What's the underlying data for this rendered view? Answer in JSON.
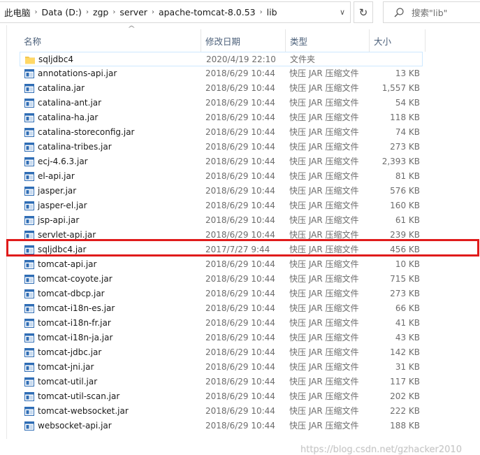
{
  "address_bar": {
    "crumbs": [
      "此电脑",
      "Data (D:)",
      "zgp",
      "server",
      "apache-tomcat-8.0.53",
      "lib"
    ]
  },
  "search": {
    "placeholder": "搜索\"lib\""
  },
  "columns": {
    "name": "名称",
    "date": "修改日期",
    "type": "类型",
    "size": "大小"
  },
  "files": [
    {
      "name": "sqljdbc4",
      "date": "2020/4/19 22:10",
      "type": "文件夹",
      "size": "",
      "icon": "folder-icon"
    },
    {
      "name": "annotations-api.jar",
      "date": "2018/6/29 10:44",
      "type": "快压 JAR 压缩文件",
      "size": "13 KB",
      "icon": "jar-file-icon"
    },
    {
      "name": "catalina.jar",
      "date": "2018/6/29 10:44",
      "type": "快压 JAR 压缩文件",
      "size": "1,557 KB",
      "icon": "jar-file-icon"
    },
    {
      "name": "catalina-ant.jar",
      "date": "2018/6/29 10:44",
      "type": "快压 JAR 压缩文件",
      "size": "54 KB",
      "icon": "jar-file-icon"
    },
    {
      "name": "catalina-ha.jar",
      "date": "2018/6/29 10:44",
      "type": "快压 JAR 压缩文件",
      "size": "118 KB",
      "icon": "jar-file-icon"
    },
    {
      "name": "catalina-storeconfig.jar",
      "date": "2018/6/29 10:44",
      "type": "快压 JAR 压缩文件",
      "size": "74 KB",
      "icon": "jar-file-icon"
    },
    {
      "name": "catalina-tribes.jar",
      "date": "2018/6/29 10:44",
      "type": "快压 JAR 压缩文件",
      "size": "273 KB",
      "icon": "jar-file-icon"
    },
    {
      "name": "ecj-4.6.3.jar",
      "date": "2018/6/29 10:44",
      "type": "快压 JAR 压缩文件",
      "size": "2,393 KB",
      "icon": "jar-file-icon"
    },
    {
      "name": "el-api.jar",
      "date": "2018/6/29 10:44",
      "type": "快压 JAR 压缩文件",
      "size": "81 KB",
      "icon": "jar-file-icon"
    },
    {
      "name": "jasper.jar",
      "date": "2018/6/29 10:44",
      "type": "快压 JAR 压缩文件",
      "size": "576 KB",
      "icon": "jar-file-icon"
    },
    {
      "name": "jasper-el.jar",
      "date": "2018/6/29 10:44",
      "type": "快压 JAR 压缩文件",
      "size": "160 KB",
      "icon": "jar-file-icon"
    },
    {
      "name": "jsp-api.jar",
      "date": "2018/6/29 10:44",
      "type": "快压 JAR 压缩文件",
      "size": "61 KB",
      "icon": "jar-file-icon"
    },
    {
      "name": "servlet-api.jar",
      "date": "2018/6/29 10:44",
      "type": "快压 JAR 压缩文件",
      "size": "239 KB",
      "icon": "jar-file-icon"
    },
    {
      "name": "sqljdbc4.jar",
      "date": "2017/7/27 9:44",
      "type": "快压 JAR 压缩文件",
      "size": "456 KB",
      "icon": "jar-file-icon",
      "highlighted": true
    },
    {
      "name": "tomcat-api.jar",
      "date": "2018/6/29 10:44",
      "type": "快压 JAR 压缩文件",
      "size": "10 KB",
      "icon": "jar-file-icon"
    },
    {
      "name": "tomcat-coyote.jar",
      "date": "2018/6/29 10:44",
      "type": "快压 JAR 压缩文件",
      "size": "715 KB",
      "icon": "jar-file-icon"
    },
    {
      "name": "tomcat-dbcp.jar",
      "date": "2018/6/29 10:44",
      "type": "快压 JAR 压缩文件",
      "size": "273 KB",
      "icon": "jar-file-icon"
    },
    {
      "name": "tomcat-i18n-es.jar",
      "date": "2018/6/29 10:44",
      "type": "快压 JAR 压缩文件",
      "size": "66 KB",
      "icon": "jar-file-icon"
    },
    {
      "name": "tomcat-i18n-fr.jar",
      "date": "2018/6/29 10:44",
      "type": "快压 JAR 压缩文件",
      "size": "41 KB",
      "icon": "jar-file-icon"
    },
    {
      "name": "tomcat-i18n-ja.jar",
      "date": "2018/6/29 10:44",
      "type": "快压 JAR 压缩文件",
      "size": "43 KB",
      "icon": "jar-file-icon"
    },
    {
      "name": "tomcat-jdbc.jar",
      "date": "2018/6/29 10:44",
      "type": "快压 JAR 压缩文件",
      "size": "142 KB",
      "icon": "jar-file-icon"
    },
    {
      "name": "tomcat-jni.jar",
      "date": "2018/6/29 10:44",
      "type": "快压 JAR 压缩文件",
      "size": "31 KB",
      "icon": "jar-file-icon"
    },
    {
      "name": "tomcat-util.jar",
      "date": "2018/6/29 10:44",
      "type": "快压 JAR 压缩文件",
      "size": "117 KB",
      "icon": "jar-file-icon"
    },
    {
      "name": "tomcat-util-scan.jar",
      "date": "2018/6/29 10:44",
      "type": "快压 JAR 压缩文件",
      "size": "202 KB",
      "icon": "jar-file-icon"
    },
    {
      "name": "tomcat-websocket.jar",
      "date": "2018/6/29 10:44",
      "type": "快压 JAR 压缩文件",
      "size": "222 KB",
      "icon": "jar-file-icon"
    },
    {
      "name": "websocket-api.jar",
      "date": "2018/6/29 10:44",
      "type": "快压 JAR 压缩文件",
      "size": "188 KB",
      "icon": "jar-file-icon"
    }
  ],
  "watermark": "https://blog.csdn.net/gzhacker2010",
  "colors": {
    "highlight_border": "#e01b1b",
    "header_text": "#4c607a",
    "secondary_text": "#6d6d6d",
    "folder": "#f3c64d",
    "jar_icon": "#2f6db5"
  }
}
